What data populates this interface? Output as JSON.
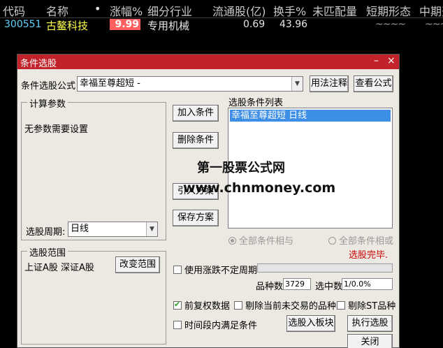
{
  "table": {
    "headers": [
      "代码",
      "名称",
      "•",
      "涨幅%",
      "细分行业",
      "流通股(亿)",
      "换手%",
      "未匹配量",
      "短期形态",
      "中期开"
    ],
    "row": {
      "code": "300551",
      "name": "古鳌科技",
      "pct": "9.99",
      "industry": "专用机械",
      "float_shares": "0.69",
      "turnover": "43.96",
      "short_term": "~~~~",
      "mid_term": "~~~~"
    }
  },
  "dialog": {
    "title": "条件选股",
    "formula_label": "条件选股公式",
    "formula_value": "幸福至尊超短 -",
    "usage_button": "用法注释",
    "view_formula_button": "查看公式",
    "params_group_title": "计算参数",
    "params_text": "无参数需要设置",
    "period_label": "选股周期:",
    "period_value": "日线",
    "add_button": "加入条件",
    "delete_button": "删除条件",
    "import_button": "引入方案",
    "save_button": "保存方案",
    "list_title": "选股条件列表",
    "list_items": [
      "幸福至尊超短   日线"
    ],
    "radio_and": "全部条件相与",
    "radio_or": "全部条件相或",
    "status": "选股完毕.",
    "range_group_title": "选股范围",
    "range_text": "上证A股  深证A股",
    "change_range_button": "改变范围",
    "use_unfixed_period": "使用涨跌不定周期",
    "count_label": "品种数",
    "count_value": "3729",
    "selected_label": "选中数",
    "selected_value": "1/0.0%",
    "adjust_label": "前复权数据",
    "exclude_untraded_label": "剔除当前未交易的品种",
    "exclude_st_label": "剔除ST品种",
    "time_condition_label": "时间段内满足条件",
    "to_board_button": "选股入板块",
    "run_button": "执行选股",
    "close_button": "关闭",
    "minimize_glyph": "–",
    "close_glyph": "×"
  },
  "watermark": {
    "line1": "第一股票公式网",
    "line2": "www.chnmoney.com"
  },
  "colors": {
    "title_bar": "#c2232a",
    "selection": "#3d8ee6",
    "status_red": "#cc0000"
  }
}
